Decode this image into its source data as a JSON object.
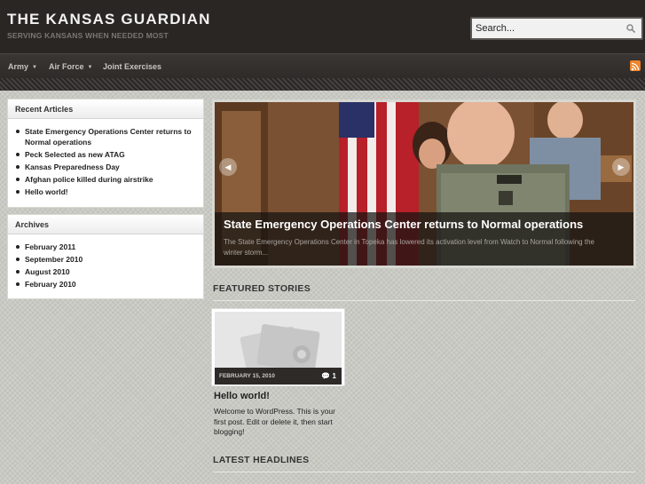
{
  "header": {
    "site_title": "THE KANSAS GUARDIAN",
    "tagline": "SERVING KANSANS WHEN NEEDED MOST",
    "search_placeholder": "Search...",
    "bg_color": "#2a2624"
  },
  "nav": {
    "items": [
      {
        "label": "Army",
        "has_dropdown": true
      },
      {
        "label": "Air Force",
        "has_dropdown": true
      },
      {
        "label": "Joint Exercises",
        "has_dropdown": false
      }
    ],
    "rss_icon": "rss-icon"
  },
  "sidebar": {
    "recent": {
      "title": "Recent Articles",
      "items": [
        "State Emergency Operations Center returns to Normal operations",
        "Peck Selected as new ATAG",
        "Kansas Preparedness Day",
        "Afghan police killed during airstrike",
        "Hello world!"
      ]
    },
    "archives": {
      "title": "Archives",
      "items": [
        "February 2011",
        "September 2010",
        "August 2010",
        "February 2010"
      ]
    }
  },
  "slider": {
    "title": "State Emergency Operations Center returns to Normal operations",
    "text": "The State Emergency Operations Center in Topeka has lowered its activation level from Watch to Normal following the winter storm...",
    "prev_icon": "arrow-left-icon",
    "next_icon": "arrow-right-icon"
  },
  "featured": {
    "heading": "FEATURED STORIES",
    "post": {
      "date": "FEBRUARY 15, 2010",
      "comments": "1",
      "title": "Hello world!",
      "excerpt": "Welcome to WordPress. This is your first post. Edit or delete it, then start blogging!"
    }
  },
  "latest": {
    "heading": "LATEST HEADLINES"
  }
}
